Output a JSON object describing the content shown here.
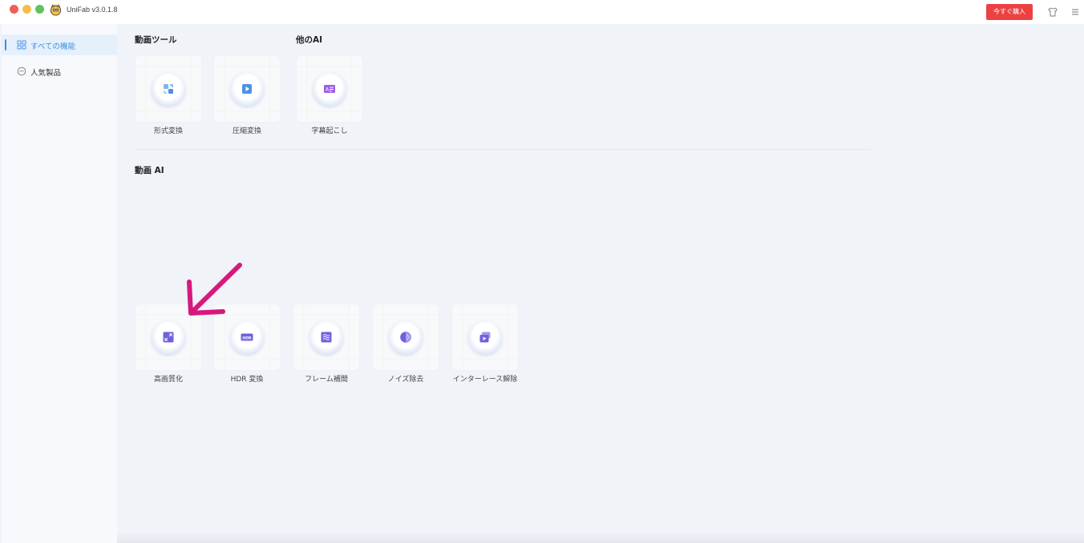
{
  "window": {
    "title": "UniFab v3.0.1.8",
    "buy_button": "今すぐ購入"
  },
  "sidebar": {
    "items": [
      {
        "label": "すべての機能",
        "icon": "grid-icon",
        "active": true
      },
      {
        "label": "人気製品",
        "icon": "circle-icon",
        "active": false
      }
    ]
  },
  "sections": {
    "video_tools": {
      "title": "動画ツール",
      "tiles": [
        {
          "label": "形式変換",
          "icon": "format-convert-icon"
        },
        {
          "label": "圧縮変換",
          "icon": "compress-icon"
        }
      ]
    },
    "other_ai": {
      "title": "他のAI",
      "tiles": [
        {
          "label": "字幕起こし",
          "icon": "subtitle-icon"
        }
      ]
    },
    "video_ai": {
      "title": "動画 AI",
      "tiles": [
        {
          "label": "高画質化",
          "icon": "upscale-icon"
        },
        {
          "label": "HDR 変換",
          "icon": "hdr-icon",
          "icon_text": "HDR"
        },
        {
          "label": "フレーム補間",
          "icon": "frame-interpolation-icon"
        },
        {
          "label": "ノイズ除去",
          "icon": "denoise-icon"
        },
        {
          "label": "インターレース解除",
          "icon": "deinterlace-icon"
        }
      ]
    }
  },
  "colors": {
    "accent": "#3a8ee6",
    "buy": "#ec4141",
    "icon_purple": "#6f62dd",
    "icon_blue": "#5ba6ea",
    "annotation_arrow": "#d6197e"
  }
}
